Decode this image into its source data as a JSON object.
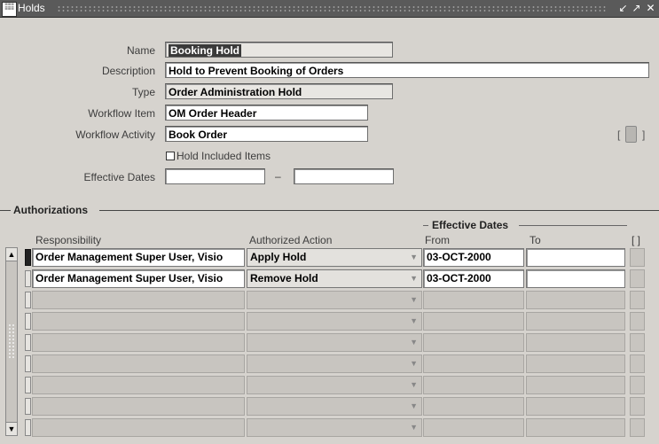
{
  "window": {
    "title": "Holds",
    "icon": "oracle-forms-icon",
    "controls": [
      "minimize-icon",
      "maximize-icon",
      "close-icon"
    ]
  },
  "form": {
    "name_label": "Name",
    "name_value": "Booking Hold",
    "description_label": "Description",
    "description_value": "Hold to Prevent Booking of Orders",
    "type_label": "Type",
    "type_value": "Order Administration Hold",
    "workflow_item_label": "Workflow Item",
    "workflow_item_value": "OM Order Header",
    "workflow_activity_label": "Workflow Activity",
    "workflow_activity_value": "Book Order",
    "hold_included_label": "Hold Included Items",
    "hold_included_checked": false,
    "effective_dates_label": "Effective Dates",
    "effective_from": "",
    "effective_to": "",
    "date_separator": "–",
    "flex_open": "[",
    "flex_close": "]"
  },
  "authorizations": {
    "section_title": "Authorizations",
    "effective_dates_group": "Effective Dates",
    "col_responsibility": "Responsibility",
    "col_action": "Authorized Action",
    "col_from": "From",
    "col_to": "To",
    "col_flex": "[ ]",
    "rows": [
      {
        "responsibility": "Order Management Super User, Visio",
        "action": "Apply Hold",
        "from": "03-OCT-2000",
        "to": ""
      },
      {
        "responsibility": "Order Management Super User, Visio",
        "action": "Remove Hold",
        "from": "03-OCT-2000",
        "to": ""
      },
      {
        "responsibility": "",
        "action": "",
        "from": "",
        "to": ""
      },
      {
        "responsibility": "",
        "action": "",
        "from": "",
        "to": ""
      },
      {
        "responsibility": "",
        "action": "",
        "from": "",
        "to": ""
      },
      {
        "responsibility": "",
        "action": "",
        "from": "",
        "to": ""
      },
      {
        "responsibility": "",
        "action": "",
        "from": "",
        "to": ""
      },
      {
        "responsibility": "",
        "action": "",
        "from": "",
        "to": ""
      },
      {
        "responsibility": "",
        "action": "",
        "from": "",
        "to": ""
      }
    ]
  }
}
